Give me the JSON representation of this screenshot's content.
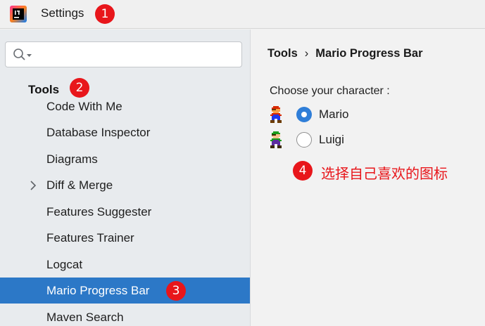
{
  "window": {
    "title": "Settings",
    "icon": "intellij-app-icon"
  },
  "search": {
    "value": "",
    "placeholder": "",
    "icon": "search-icon"
  },
  "sidebar": {
    "section_label": "Tools",
    "items": [
      {
        "label": "Code With Me",
        "expandable": false,
        "selected": false
      },
      {
        "label": "Database Inspector",
        "expandable": false,
        "selected": false
      },
      {
        "label": "Diagrams",
        "expandable": false,
        "selected": false
      },
      {
        "label": "Diff & Merge",
        "expandable": true,
        "selected": false
      },
      {
        "label": "Features Suggester",
        "expandable": false,
        "selected": false
      },
      {
        "label": "Features Trainer",
        "expandable": false,
        "selected": false
      },
      {
        "label": "Logcat",
        "expandable": false,
        "selected": false
      },
      {
        "label": "Mario Progress Bar",
        "expandable": false,
        "selected": true
      },
      {
        "label": "Maven Search",
        "expandable": false,
        "selected": false
      }
    ]
  },
  "content": {
    "breadcrumb": {
      "parent": "Tools",
      "separator": "›",
      "current": "Mario Progress Bar"
    },
    "choose_label": "Choose your character :",
    "options": [
      {
        "label": "Mario",
        "checked": true,
        "icon": "mario-sprite-icon"
      },
      {
        "label": "Luigi",
        "checked": false,
        "icon": "luigi-sprite-icon"
      }
    ]
  },
  "annotations": {
    "badges": [
      "1",
      "2",
      "3",
      "4"
    ],
    "hint_text": "选择自己喜欢的图标"
  },
  "colors": {
    "selection": "#2c78c7",
    "badge": "#e8161b",
    "radio_accent": "#2f7ed8"
  }
}
